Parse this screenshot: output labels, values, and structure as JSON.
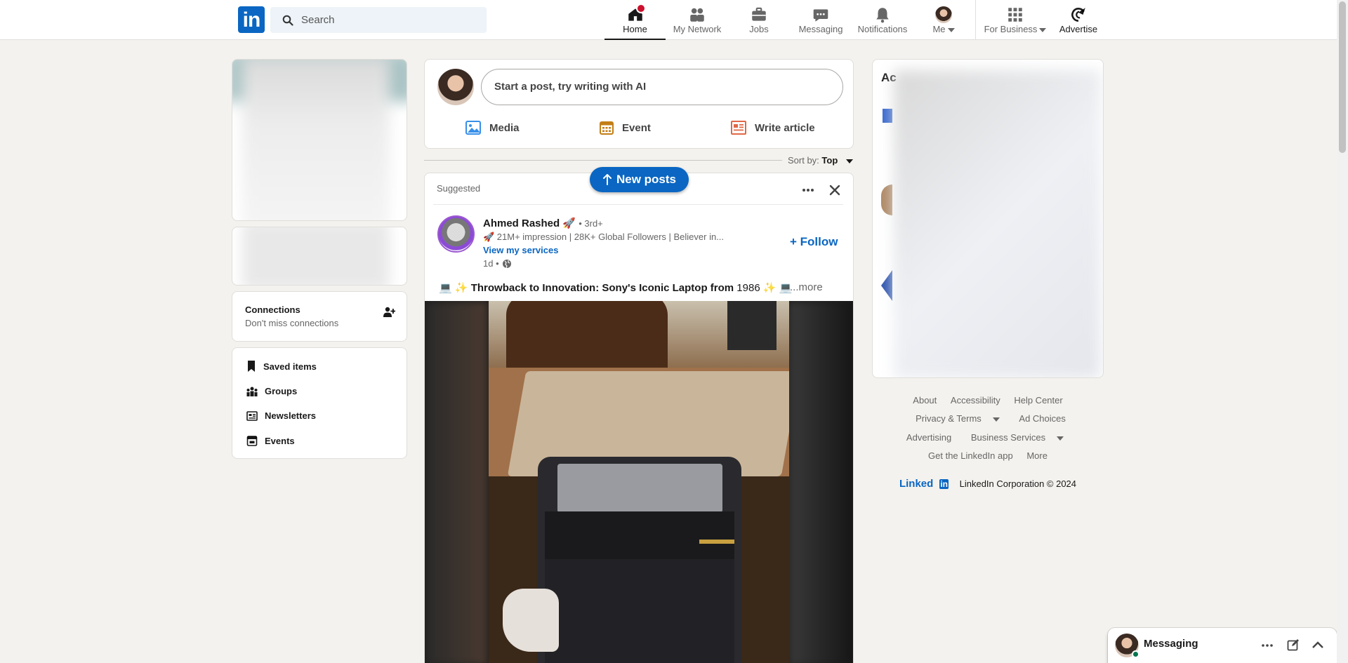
{
  "nav": {
    "logo": "in",
    "search_placeholder": "Search",
    "items": [
      {
        "label": "Home"
      },
      {
        "label": "My Network"
      },
      {
        "label": "Jobs"
      },
      {
        "label": "Messaging"
      },
      {
        "label": "Notifications"
      },
      {
        "label": "Me"
      },
      {
        "label": "For Business"
      },
      {
        "label": "Advertise"
      }
    ]
  },
  "left": {
    "connections_title": "Connections",
    "connections_sub": "Don't miss connections",
    "links": [
      "Saved items",
      "Groups",
      "Newsletters",
      "Events"
    ]
  },
  "share": {
    "placeholder": "Start a post, try writing with AI",
    "actions": [
      "Media",
      "Event",
      "Write article"
    ]
  },
  "sort": {
    "label": "Sort by:",
    "value": "Top"
  },
  "new_posts": "New posts",
  "post": {
    "suggested": "Suggested",
    "author": "Ahmed Rashed 🚀",
    "degree": "• 3rd+",
    "tagline": "🚀 21M+ impression | 28K+ Global Followers | Believer in...",
    "services": "View my services",
    "time": "1d •",
    "follow": "+ Follow",
    "text_prefix": "💻 ✨ ",
    "text_bold": "Throwback to Innovation: Sony's Iconic Laptop from",
    "text_year": " 1986 ✨ 💻",
    "more": "...more"
  },
  "right": {
    "ad_label": "Ac",
    "footer_rows": [
      [
        "About",
        "Accessibility",
        "Help Center"
      ],
      [
        "Privacy & Terms",
        "Ad Choices"
      ],
      [
        "Advertising",
        "Business Services"
      ],
      [
        "Get the LinkedIn app",
        "More"
      ]
    ],
    "brand": "Linked",
    "brand_in": "in",
    "copyright": "LinkedIn Corporation © 2024"
  },
  "messaging": {
    "title": "Messaging"
  }
}
